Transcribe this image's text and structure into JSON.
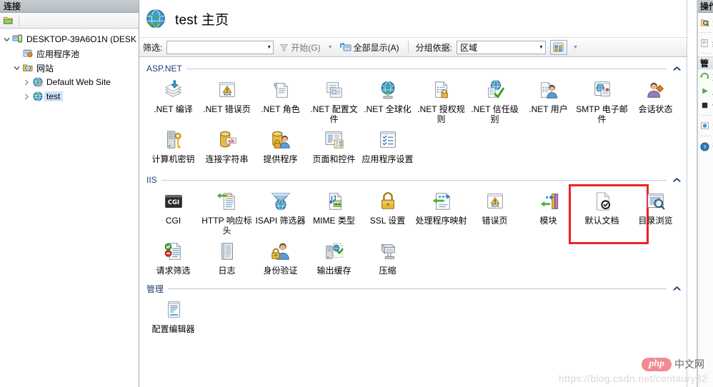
{
  "connections": {
    "header": "连接",
    "toolbar": {
      "open_icon": "open-folder-icon"
    },
    "tree": [
      {
        "label": "DESKTOP-39A6O1N (DESK",
        "icon": "server-icon",
        "level": 0,
        "expanded": true,
        "selected": false
      },
      {
        "label": "应用程序池",
        "icon": "app-pools-icon",
        "level": 1,
        "expanded": null,
        "selected": false
      },
      {
        "label": "网站",
        "icon": "sites-folder-icon",
        "level": 1,
        "expanded": true,
        "selected": false
      },
      {
        "label": "Default Web Site",
        "icon": "website-icon",
        "level": 2,
        "expanded": false,
        "selected": false
      },
      {
        "label": "test",
        "icon": "website-icon",
        "level": 2,
        "expanded": false,
        "selected": true
      }
    ]
  },
  "page": {
    "title": "test 主页",
    "title_icon": "globe-icon"
  },
  "filter_bar": {
    "filter_label": "筛选:",
    "filter_value": "",
    "filter_placeholder": "",
    "go_label": "开始(G)",
    "show_all_label": "全部显示(A)",
    "group_by_label": "分组依据:",
    "group_by_value": "区域",
    "view_icon": "view-tiles-icon"
  },
  "groups": [
    {
      "title": "ASP.NET",
      "collapse_icon": "chevron-up-icon",
      "items": [
        {
          "label": ".NET 编译",
          "icon": "net-compilation-icon"
        },
        {
          "label": ".NET 错误页",
          "icon": "net-error-pages-icon"
        },
        {
          "label": ".NET 角色",
          "icon": "net-roles-icon"
        },
        {
          "label": ".NET 配置文件",
          "icon": "net-profile-icon"
        },
        {
          "label": ".NET 全球化",
          "icon": "net-globalization-icon"
        },
        {
          "label": ".NET 授权规则",
          "icon": "net-auth-rules-icon"
        },
        {
          "label": ".NET 信任级别",
          "icon": "net-trust-levels-icon"
        },
        {
          "label": ".NET 用户",
          "icon": "net-users-icon"
        },
        {
          "label": "SMTP 电子邮件",
          "icon": "smtp-email-icon"
        },
        {
          "label": "会话状态",
          "icon": "session-state-icon"
        },
        {
          "label": "计算机密钥",
          "icon": "machine-key-icon"
        },
        {
          "label": "连接字符串",
          "icon": "connection-strings-icon"
        },
        {
          "label": "提供程序",
          "icon": "providers-icon"
        },
        {
          "label": "页面和控件",
          "icon": "pages-controls-icon"
        },
        {
          "label": "应用程序设置",
          "icon": "application-settings-icon"
        }
      ]
    },
    {
      "title": "IIS",
      "collapse_icon": "chevron-up-icon",
      "items": [
        {
          "label": "CGI",
          "icon": "cgi-icon"
        },
        {
          "label": "HTTP 响应标头",
          "icon": "http-response-headers-icon"
        },
        {
          "label": "ISAPI 筛选器",
          "icon": "isapi-filters-icon"
        },
        {
          "label": "MIME 类型",
          "icon": "mime-types-icon"
        },
        {
          "label": "SSL 设置",
          "icon": "ssl-settings-icon"
        },
        {
          "label": "处理程序映射",
          "icon": "handler-mappings-icon"
        },
        {
          "label": "错误页",
          "icon": "error-pages-icon"
        },
        {
          "label": "模块",
          "icon": "modules-icon"
        },
        {
          "label": "默认文档",
          "icon": "default-document-icon",
          "highlighted": true
        },
        {
          "label": "目录浏览",
          "icon": "directory-browsing-icon"
        },
        {
          "label": "请求筛选",
          "icon": "request-filtering-icon"
        },
        {
          "label": "日志",
          "icon": "logging-icon"
        },
        {
          "label": "身份验证",
          "icon": "authentication-icon"
        },
        {
          "label": "输出缓存",
          "icon": "output-caching-icon"
        },
        {
          "label": "压缩",
          "icon": "compression-icon"
        }
      ]
    },
    {
      "title": "管理",
      "collapse_icon": "chevron-up-icon",
      "items": [
        {
          "label": "配置编辑器",
          "icon": "configuration-editor-icon"
        }
      ]
    }
  ],
  "actions_panel": {
    "header": "操作",
    "items": [
      {
        "label": "浏",
        "icon": "explore-icon"
      },
      {
        "label": "编",
        "icon": "edit-permissions-icon"
      },
      {
        "label": "管",
        "icon": "manage-website-icon"
      },
      {
        "label": "重",
        "icon": "restart-icon"
      },
      {
        "label": "启",
        "icon": "start-icon"
      },
      {
        "label": "停",
        "icon": "stop-icon"
      },
      {
        "label": "浏",
        "icon": "browse-website-icon"
      },
      {
        "label": "帮",
        "icon": "help-icon"
      }
    ]
  },
  "watermark": {
    "url": "https://blog.csdn.net/centaury32",
    "logo_text": "php",
    "logo_suffix": "中文网"
  }
}
